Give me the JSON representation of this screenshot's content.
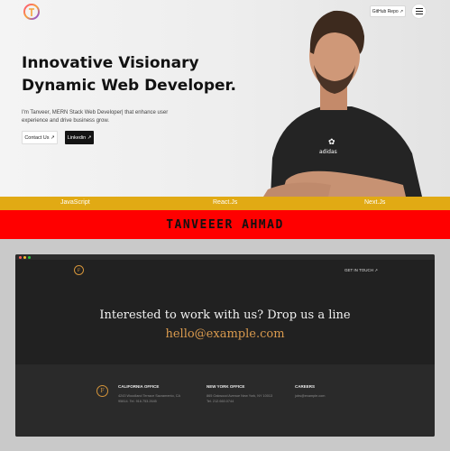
{
  "hero": {
    "title_line1": "Innovative Visionary",
    "title_line2": "Dynamic Web Developer.",
    "description": "I'm Tanveer, MERN Stack Web Developer| that enhance user experience and drive business grow.",
    "contact_label": "Contact Us ↗",
    "linkedin_label": "Linkedin ↗",
    "github_label": "GitHub Repo ↗"
  },
  "skills": [
    "JavaScript",
    "React.Js",
    "Next.Js"
  ],
  "banner": {
    "name": "TANVEEER AHMAD"
  },
  "preview": {
    "logo_letter": "F",
    "get_in_touch": "GET IN TOUCH ↗",
    "cta_title": "Interested to work with us? Drop us a line",
    "cta_email": "hello@example.com",
    "footer": {
      "logo_letter": "F",
      "california": {
        "heading": "CALIFORNIA OFFICE",
        "line1": "4243 Woodland Terrace Sacramento, CA",
        "line2": "95814. Tel. 916.753.2645"
      },
      "newyork": {
        "heading": "NEW YORK OFFICE",
        "line1": "865 Oakwood Avenue New York, NY 10013",
        "line2": "Tel. 212.660.0744"
      },
      "careers": {
        "heading": "CAREERS",
        "line1": "jobs@example.com"
      }
    }
  },
  "colors": {
    "skills_bar": "#e1aa14",
    "banner": "#ff0000",
    "accent": "#d99a4e"
  },
  "icons": {
    "logo": "gradient-circle-logo-icon",
    "menu": "hamburger-menu-icon"
  }
}
